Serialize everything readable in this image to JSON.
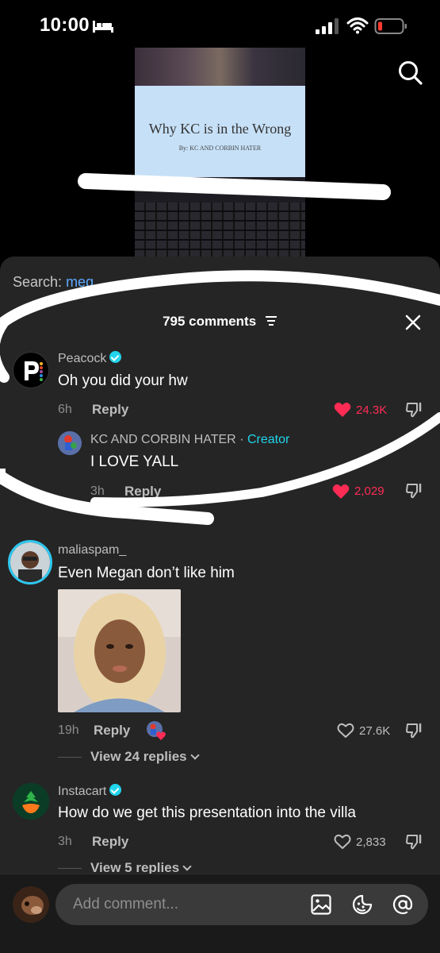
{
  "status_bar": {
    "time": "10:00"
  },
  "video": {
    "slide_title": "Why KC is in the Wrong",
    "slide_subtitle": "By: KC AND CORBIN HATER"
  },
  "sheet": {
    "search_label": "Search:",
    "search_query": "meg",
    "comments_count": "795 comments",
    "comments": [
      {
        "username": "Peacock",
        "verified": true,
        "text": "Oh you did your hw",
        "time": "6h",
        "reply_label": "Reply",
        "likes": "24.3K",
        "liked": true
      },
      {
        "username": "KC AND CORBIN HATER",
        "creator_label": "Creator",
        "separator": "·",
        "text": "I LOVE YALL",
        "time": "3h",
        "reply_label": "Reply",
        "likes": "2,029",
        "liked": true
      },
      {
        "username": "maliaspam_",
        "text": "Even Megan don’t like him",
        "time": "19h",
        "reply_label": "Reply",
        "likes": "27.6K",
        "liked": false,
        "view_replies": "View 24 replies"
      },
      {
        "username": "Instacart",
        "verified": true,
        "text": "How do we get this presentation into the villa",
        "time": "3h",
        "reply_label": "Reply",
        "likes": "2,833",
        "liked": false,
        "view_replies": "View 5 replies"
      }
    ]
  },
  "bottom_bar": {
    "placeholder": "Add comment..."
  },
  "colors": {
    "like_red": "#fe2c55",
    "creator_cyan": "#20d5ec",
    "sheet_bg": "#252525",
    "link_blue": "#5ea9ff"
  }
}
